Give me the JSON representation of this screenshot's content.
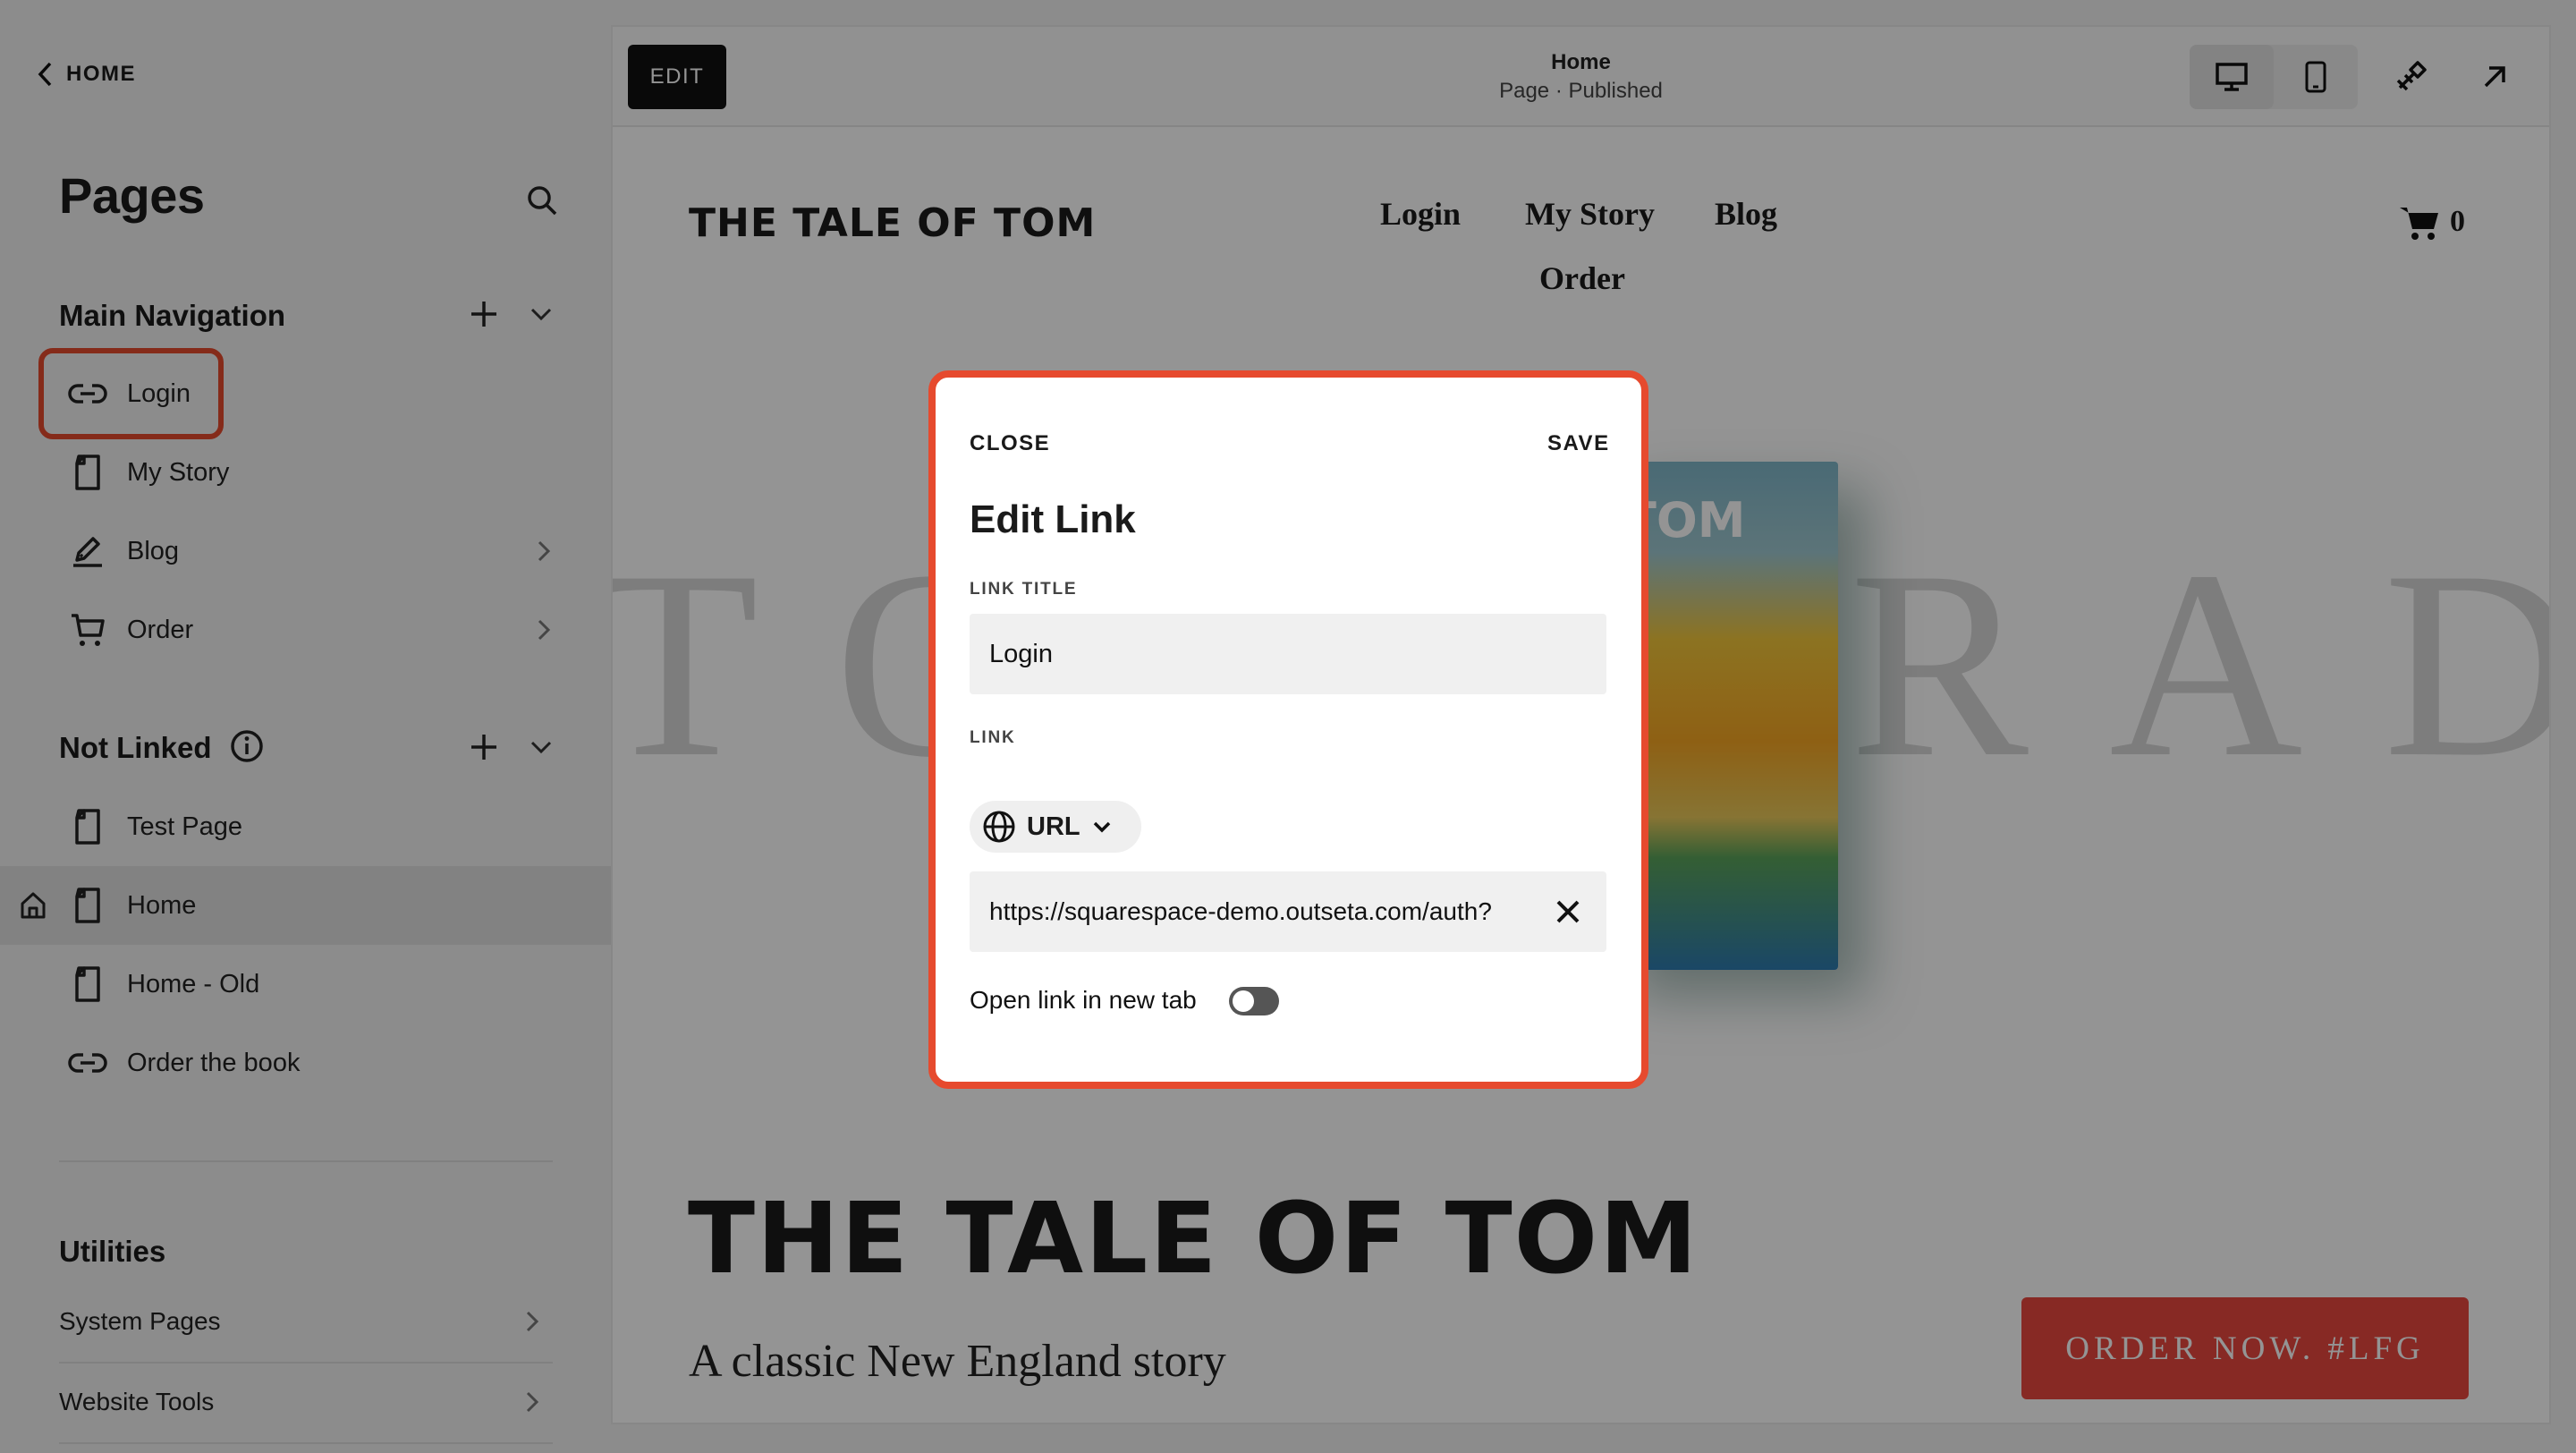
{
  "sidebar": {
    "back_label": "HOME",
    "title": "Pages",
    "main_nav": {
      "heading": "Main Navigation",
      "items": [
        {
          "label": "Login",
          "icon": "link-icon",
          "chevron": false
        },
        {
          "label": "My Story",
          "icon": "page-icon",
          "chevron": false
        },
        {
          "label": "Blog",
          "icon": "blog-icon",
          "chevron": true
        },
        {
          "label": "Order",
          "icon": "cart-icon",
          "chevron": true
        }
      ]
    },
    "not_linked": {
      "heading": "Not Linked",
      "items": [
        {
          "label": "Test Page",
          "icon": "page-icon"
        },
        {
          "label": "Home",
          "icon": "page-icon",
          "is_homepage": true
        },
        {
          "label": "Home - Old",
          "icon": "page-icon"
        },
        {
          "label": "Order the book",
          "icon": "link-icon"
        }
      ]
    },
    "utilities": {
      "heading": "Utilities",
      "items": [
        {
          "label": "System Pages"
        },
        {
          "label": "Website Tools"
        }
      ]
    }
  },
  "topbar": {
    "edit_label": "EDIT",
    "page_name": "Home",
    "page_status": "Page · Published"
  },
  "site": {
    "logo": "THE TALE OF TOM",
    "nav": [
      "Login",
      "My Story",
      "Blog",
      "Order"
    ],
    "cart_count": "0",
    "background_text": "TOM GRADY",
    "book_cover_text": "TOM",
    "hero_title": "THE TALE OF TOM",
    "hero_subtitle": "A classic New England story",
    "order_button": "ORDER NOW. #LFG"
  },
  "modal": {
    "close_label": "CLOSE",
    "save_label": "SAVE",
    "title": "Edit Link",
    "link_title_label": "LINK TITLE",
    "link_title_value": "Login",
    "link_label": "LINK",
    "link_type": "URL",
    "url_value": "https://squarespace-demo.outseta.com/auth?",
    "new_tab_label": "Open link in new tab",
    "new_tab_enabled": false
  },
  "colors": {
    "highlight": "#e64a2e",
    "order_button": "#e8473f",
    "overlay": "rgba(0,0,0,0.42)"
  }
}
